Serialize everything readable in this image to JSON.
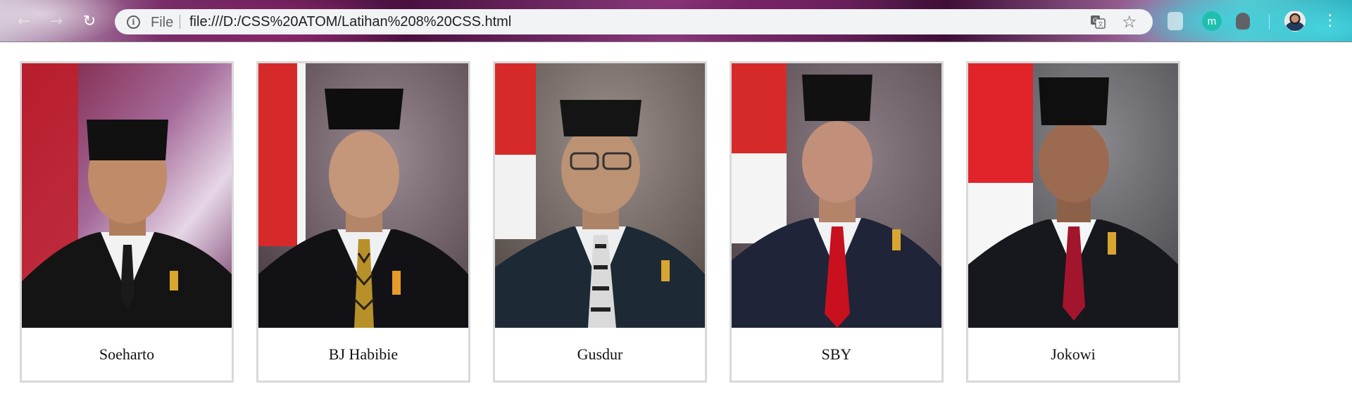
{
  "browser": {
    "scheme_label": "File",
    "url": "file:///D:/CSS%20ATOM/Latihan%208%20CSS.html",
    "icons": {
      "back": "back-arrow-icon",
      "forward": "forward-arrow-icon",
      "reload": "reload-icon",
      "info": "info-icon",
      "translate": "translate-icon",
      "bookmark": "star-icon",
      "ext1": "shopping-bag-extension-icon",
      "ext2": "m-extension-icon",
      "ext3": "lightbulb-extension-icon",
      "profile": "avatar",
      "menu": "three-dot-menu-icon"
    },
    "ext_m_label": "m"
  },
  "gallery": {
    "cards": [
      {
        "name": "Soeharto",
        "backdrop": "purple-drape",
        "tie": "black"
      },
      {
        "name": "BJ Habibie",
        "backdrop": "grey-red-flag",
        "tie": "gold-pattern"
      },
      {
        "name": "Gusdur",
        "backdrop": "grey-red-flag",
        "tie": "checkered"
      },
      {
        "name": "SBY",
        "backdrop": "grey-red-flag",
        "tie": "red"
      },
      {
        "name": "Jokowi",
        "backdrop": "grey-red-flag",
        "tie": "red"
      }
    ]
  },
  "colors": {
    "card_border": "#d9d9d9",
    "omnibox_bg": "#f1f3f4",
    "flag_red": "#d62a2a",
    "suit_dark": "#1d1f26"
  }
}
